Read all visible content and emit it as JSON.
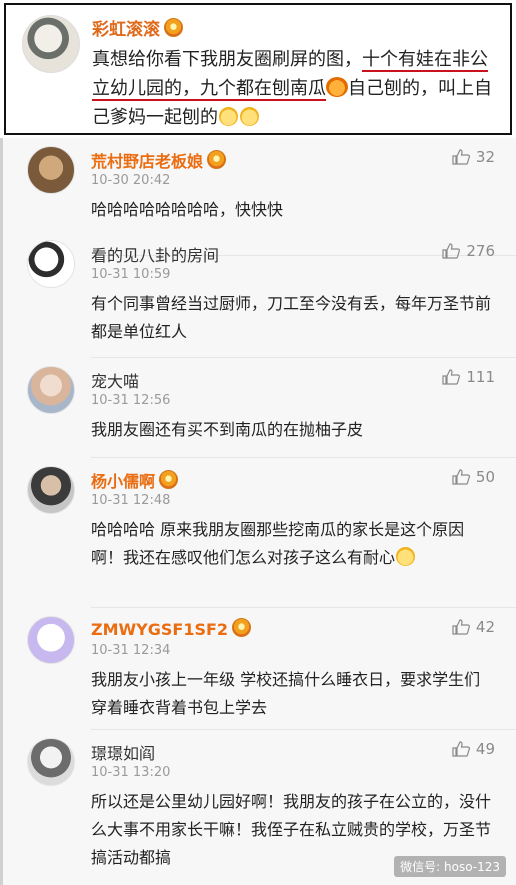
{
  "post": {
    "author": "彩虹滚滚",
    "text_before": "真想给你看下我朋友圈刷屏的图，",
    "text_underlined": "十个有娃在非公立幼儿园的，九个都在刨南瓜",
    "text_after": "自己刨的，叫上自己爹妈一起刨的"
  },
  "comments": [
    {
      "name": "荒村野店老板娘",
      "time": "10-30 20:42",
      "likes": "32",
      "text": "哈哈哈哈哈哈哈哈，快快快",
      "name_style": "orange"
    },
    {
      "name": "看的见八卦的房间",
      "time": "10-31 10:59",
      "likes": "276",
      "text": "有个同事曾经当过厨师，刀工至今没有丢，每年万圣节前都是单位红人",
      "name_style": "plain"
    },
    {
      "name": "宠大喵",
      "time": "10-31 12:56",
      "likes": "111",
      "text": "我朋友圈还有买不到南瓜的在抛柚子皮",
      "name_style": "plain"
    },
    {
      "name": "杨小儒啊",
      "time": "10-31 12:48",
      "likes": "50",
      "text": "哈哈哈哈 原来我朋友圈那些挖南瓜的家长是这个原因啊！我还在感叹他们怎么对孩子这么有耐心",
      "name_style": "orange"
    },
    {
      "name": "ZMWYGSF1SF2",
      "time": "10-31 12:34",
      "likes": "42",
      "text": "我朋友小孩上一年级 学校还搞什么睡衣日，要求学生们穿着睡衣背着书包上学去",
      "name_style": "orange"
    },
    {
      "name": "璟璟如阎",
      "time": "10-31 13:20",
      "likes": "49",
      "text": "所以还是公里幼儿园好啊！我朋友的孩子在公立的，没什么大事不用家长干嘛！我侄子在私立贼贵的学校，万圣节搞活动都搞",
      "name_style": "plain"
    }
  ],
  "watermark": "微信号: hoso-123",
  "colors": {
    "accent": "#ea6d12",
    "underline": "#c8121d"
  }
}
